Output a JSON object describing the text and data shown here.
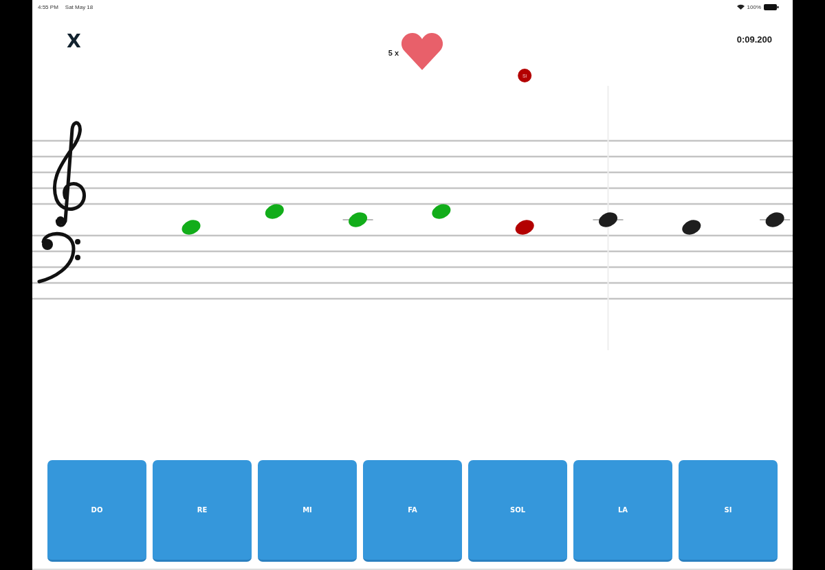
{
  "status_bar": {
    "time": "4:55 PM",
    "date": "Sat May 18",
    "battery": "100%"
  },
  "header": {
    "close_label": "X",
    "lives": "5 x",
    "timer": "0:09.200"
  },
  "notes": [
    {
      "kind": "low",
      "color": "#12ad1a",
      "playhead": false
    },
    {
      "kind": "high",
      "color": "#12ad1a",
      "playhead": false
    },
    {
      "kind": "ledger",
      "color": "#12ad1a",
      "playhead": false
    },
    {
      "kind": "high",
      "color": "#12ad1a",
      "playhead": false
    },
    {
      "kind": "low",
      "color": "#b30000",
      "playhead": false,
      "marker": "Si"
    },
    {
      "kind": "ledger",
      "color": "#1e1e1e",
      "playhead": true
    },
    {
      "kind": "low",
      "color": "#1e1e1e",
      "playhead": false
    },
    {
      "kind": "ledger",
      "color": "#1e1e1e",
      "playhead": false
    }
  ],
  "answer_buttons": [
    "DO",
    "RE",
    "MI",
    "FA",
    "SOL",
    "LA",
    "SI"
  ]
}
